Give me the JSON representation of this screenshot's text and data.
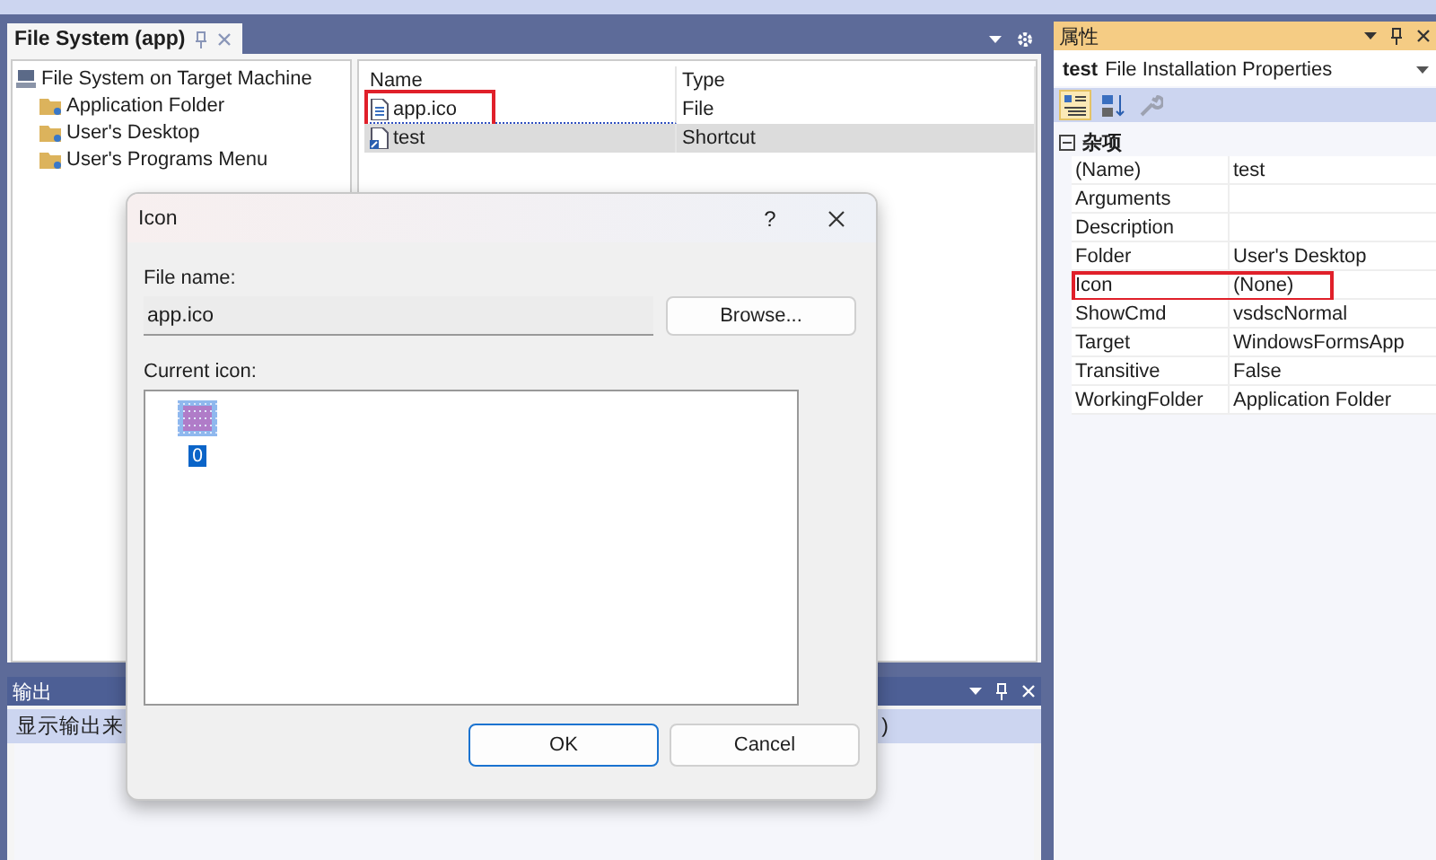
{
  "document_tab": {
    "title": "File System (app)",
    "selected": true
  },
  "tree": {
    "label": "File System on Target Machine",
    "children": [
      {
        "label": "Application Folder"
      },
      {
        "label": "User's Desktop"
      },
      {
        "label": "User's Programs Menu"
      }
    ]
  },
  "file_list": {
    "columns": [
      "Name",
      "Type"
    ],
    "rows": [
      {
        "kind": "file",
        "name": "app.ico",
        "type": "File",
        "selected": false,
        "focused": true,
        "highlighted": true
      },
      {
        "kind": "shortcut",
        "name": "test",
        "type": "Shortcut",
        "selected": true,
        "focused": false,
        "highlighted": false
      }
    ]
  },
  "output_panel": {
    "title": "输出",
    "source_label": "显示输出来",
    "trailing_text": ")"
  },
  "properties": {
    "title": "属性",
    "object_name": "test",
    "object_type": "File Installation Properties",
    "toolbar": [
      {
        "kind": "categorized",
        "selected": true,
        "disabled": false
      },
      {
        "kind": "alphabetical",
        "selected": false,
        "disabled": false
      },
      {
        "kind": "pages",
        "selected": false,
        "disabled": true
      }
    ],
    "category": {
      "label": "杂项",
      "expanded": true
    },
    "rows": [
      {
        "name": "(Name)",
        "value": "test",
        "highlighted": false
      },
      {
        "name": "Arguments",
        "highlighted": false
      },
      {
        "name": "Description",
        "highlighted": false
      },
      {
        "name": "Folder",
        "value": "User's Desktop",
        "highlighted": false
      },
      {
        "name": "Icon",
        "value": "(None)",
        "highlighted": true
      },
      {
        "name": "ShowCmd",
        "value": "vsdscNormal",
        "highlighted": false
      },
      {
        "name": "Target",
        "value": "WindowsFormsApp",
        "highlighted": false
      },
      {
        "name": "Transitive",
        "value": "False",
        "highlighted": false
      },
      {
        "name": "WorkingFolder",
        "value": "Application Folder",
        "highlighted": false
      }
    ]
  },
  "dialog": {
    "title": "Icon",
    "help": "?",
    "file_name_label": "File name:",
    "file_name": "app.ico",
    "browse_button": "Browse...",
    "current_icon_label": "Current icon:",
    "icons": [
      {
        "label": "0",
        "selected": true
      }
    ],
    "buttons": [
      {
        "label": "OK",
        "default": true
      },
      {
        "label": "Cancel",
        "default": false
      }
    ]
  }
}
